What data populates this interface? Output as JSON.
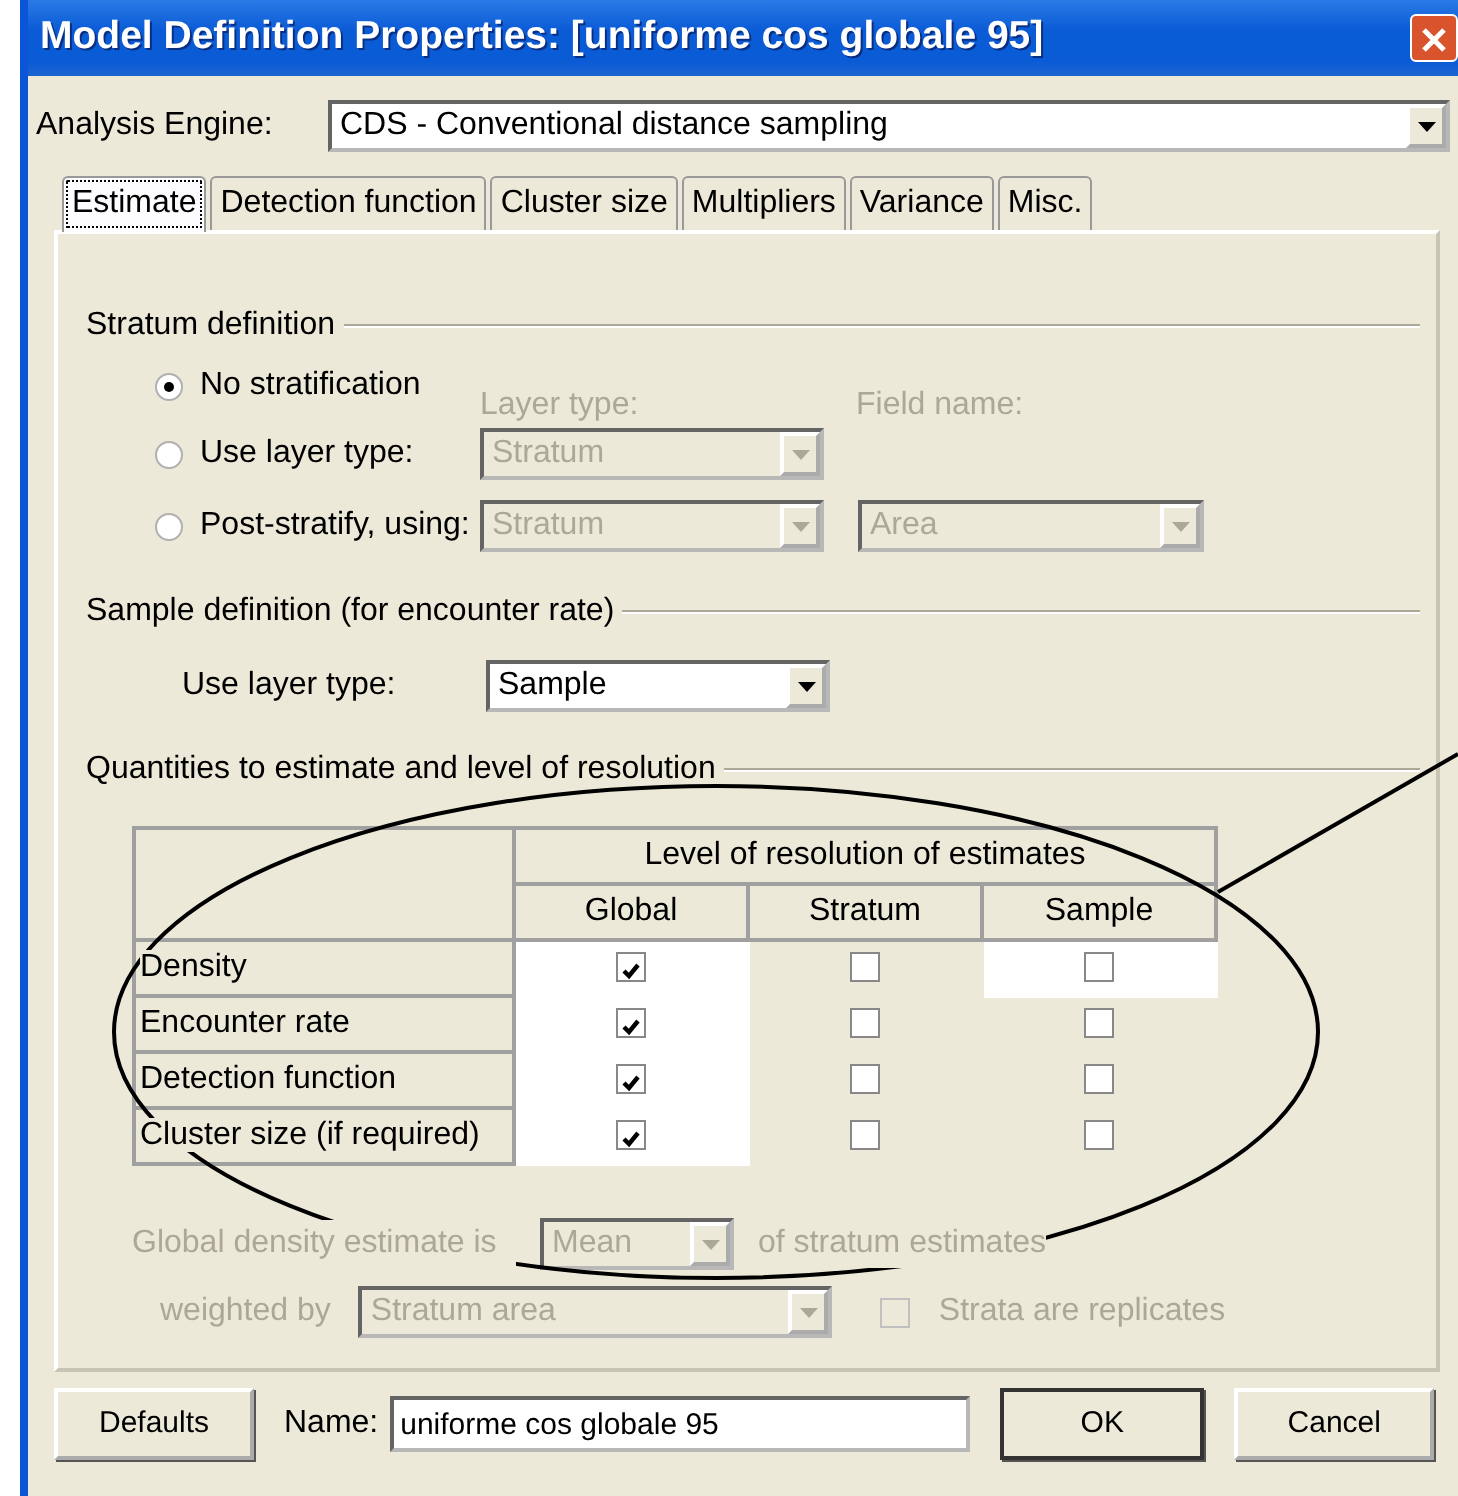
{
  "window": {
    "title": "Model Definition Properties: [uniforme cos globale 95]"
  },
  "analysis_engine": {
    "label": "Analysis Engine:",
    "value": "CDS - Conventional distance sampling"
  },
  "tabs": [
    {
      "label": "Estimate",
      "selected": true
    },
    {
      "label": "Detection function",
      "selected": false
    },
    {
      "label": "Cluster size",
      "selected": false
    },
    {
      "label": "Multipliers",
      "selected": false
    },
    {
      "label": "Variance",
      "selected": false
    },
    {
      "label": "Misc.",
      "selected": false
    }
  ],
  "stratum_definition": {
    "title": "Stratum definition",
    "layer_type_label": "Layer type:",
    "field_name_label": "Field name:",
    "options": [
      {
        "label": "No stratification",
        "selected": true
      },
      {
        "label": "Use layer type:",
        "selected": false,
        "layer_type": "Stratum"
      },
      {
        "label": "Post-stratify, using:",
        "selected": false,
        "layer_type": "Stratum",
        "field_name": "Area"
      }
    ]
  },
  "sample_definition": {
    "title": "Sample definition (for encounter rate)",
    "label": "Use layer type:",
    "value": "Sample",
    "disabled": false
  },
  "quantities": {
    "title": "Quantities to estimate and level of resolution",
    "group_header": "Level of resolution of estimates",
    "columns": [
      "Global",
      "Stratum",
      "Sample"
    ],
    "rows": [
      {
        "label": "Density",
        "cells": [
          {
            "checked": true,
            "enabled": true
          },
          {
            "checked": false,
            "enabled": false
          },
          {
            "checked": false,
            "enabled": true
          }
        ]
      },
      {
        "label": "Encounter rate",
        "cells": [
          {
            "checked": true,
            "enabled": true
          },
          {
            "checked": false,
            "enabled": false
          },
          {
            "checked": false,
            "enabled": false
          }
        ]
      },
      {
        "label": "Detection function",
        "cells": [
          {
            "checked": true,
            "enabled": true
          },
          {
            "checked": false,
            "enabled": false
          },
          {
            "checked": false,
            "enabled": false
          }
        ]
      },
      {
        "label": "Cluster size (if required)",
        "cells": [
          {
            "checked": true,
            "enabled": true
          },
          {
            "checked": false,
            "enabled": false
          },
          {
            "checked": false,
            "enabled": false
          }
        ]
      }
    ]
  },
  "global_density": {
    "prefix": "Global density estimate is",
    "value": "Mean",
    "suffix": "of stratum estimates",
    "weighted_label": "weighted by",
    "weighted_value": "Stratum area",
    "replicates_label": "Strata are replicates",
    "replicates_checked": false,
    "disabled": true
  },
  "footer": {
    "defaults_button": "Defaults",
    "name_label": "Name:",
    "name_value": "uniforme cos globale 95",
    "ok_button": "OK",
    "cancel_button": "Cancel"
  }
}
